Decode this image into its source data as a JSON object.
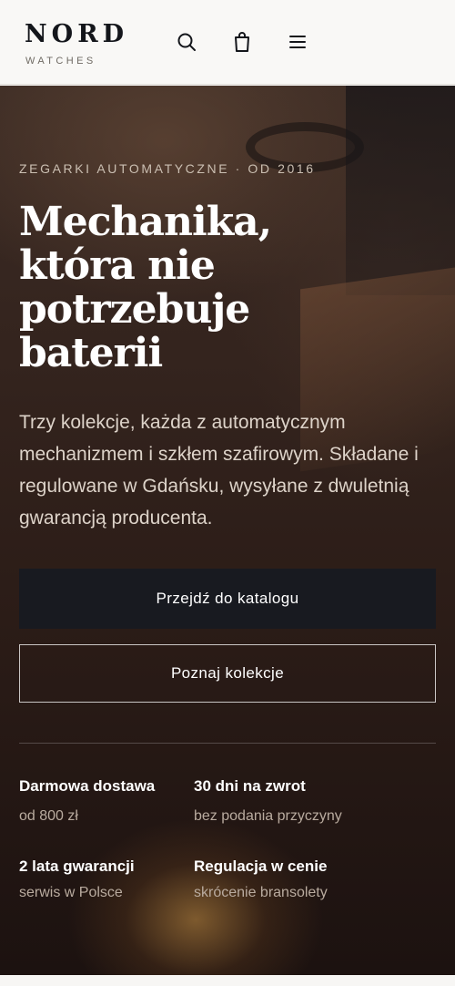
{
  "brand": {
    "name": "NORD",
    "tagline": "WATCHES"
  },
  "header_icons": [
    "search-icon",
    "bag-icon",
    "menu-icon"
  ],
  "hero": {
    "eyebrow": "ZEGARKI AUTOMATYCZNE · OD 2016",
    "headline_lines": [
      "Mechanika,",
      "która nie",
      "potrzebuje",
      "baterii"
    ],
    "lead": "Trzy kolekcje, każda z automatycznym mechanizmem i szkłem szafirowym. Składane i regulowane w Gdańsku, wysyłane z dwuletnią gwarancją producenta.",
    "primary_button": "Przejdź do katalogu",
    "secondary_button": "Poznaj kolekcje"
  },
  "features": [
    {
      "title": "Darmowa dostawa",
      "subtitle": "od 800 zł"
    },
    {
      "title": "30 dni na zwrot",
      "subtitle": "bez podania przyczyny"
    },
    {
      "title": "2 lata gwarancji",
      "subtitle": "serwis w Polsce"
    },
    {
      "title": "Regulacja w cenie",
      "subtitle": "skrócenie bransolety"
    }
  ],
  "colors": {
    "ink": "#14161b",
    "header_bg": "#f9f8f6",
    "hero_overlay": "#2b1c17",
    "button_dark": "#181a20"
  }
}
